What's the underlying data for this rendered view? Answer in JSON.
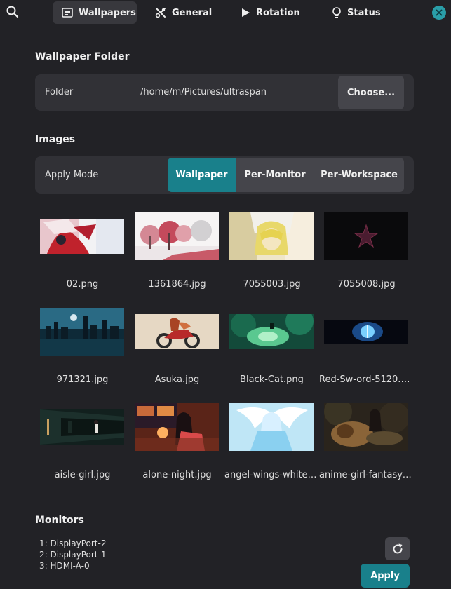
{
  "tabs": [
    {
      "label": "Wallpapers",
      "icon": "image-icon",
      "active": true
    },
    {
      "label": "General",
      "icon": "tools-icon",
      "active": false
    },
    {
      "label": "Rotation",
      "icon": "play-icon",
      "active": false
    },
    {
      "label": "Status",
      "icon": "bulb-icon",
      "active": false
    }
  ],
  "folder_section": {
    "title": "Wallpaper Folder",
    "label": "Folder",
    "path": "/home/m/Pictures/ultraspan",
    "choose_label": "Choose..."
  },
  "images_section": {
    "title": "Images",
    "apply_mode_label": "Apply Mode",
    "modes": [
      "Wallpaper",
      "Per-Monitor",
      "Per-Workspace"
    ],
    "selected_mode": "Wallpaper"
  },
  "images": [
    "02.png",
    "1361864.jpg",
    "7055003.jpg",
    "7055008.jpg",
    "971321.jpg",
    "Asuka.jpg",
    "Black-Cat.png",
    "Red-Sw-ord-5120.png",
    "aisle-girl.jpg",
    "alone-night.jpg",
    "angel-wings-white-h...",
    "anime-girl-fantasy-li..."
  ],
  "monitors_section": {
    "title": "Monitors",
    "monitors": [
      "1: DisplayPort-2",
      "2: DisplayPort-1",
      "3: HDMI-A-0"
    ],
    "apply_label": "Apply"
  },
  "colors": {
    "background": "#222226",
    "panel": "#313136",
    "button": "#45454b",
    "accent": "#19808b",
    "close": "#2a9ea8"
  }
}
